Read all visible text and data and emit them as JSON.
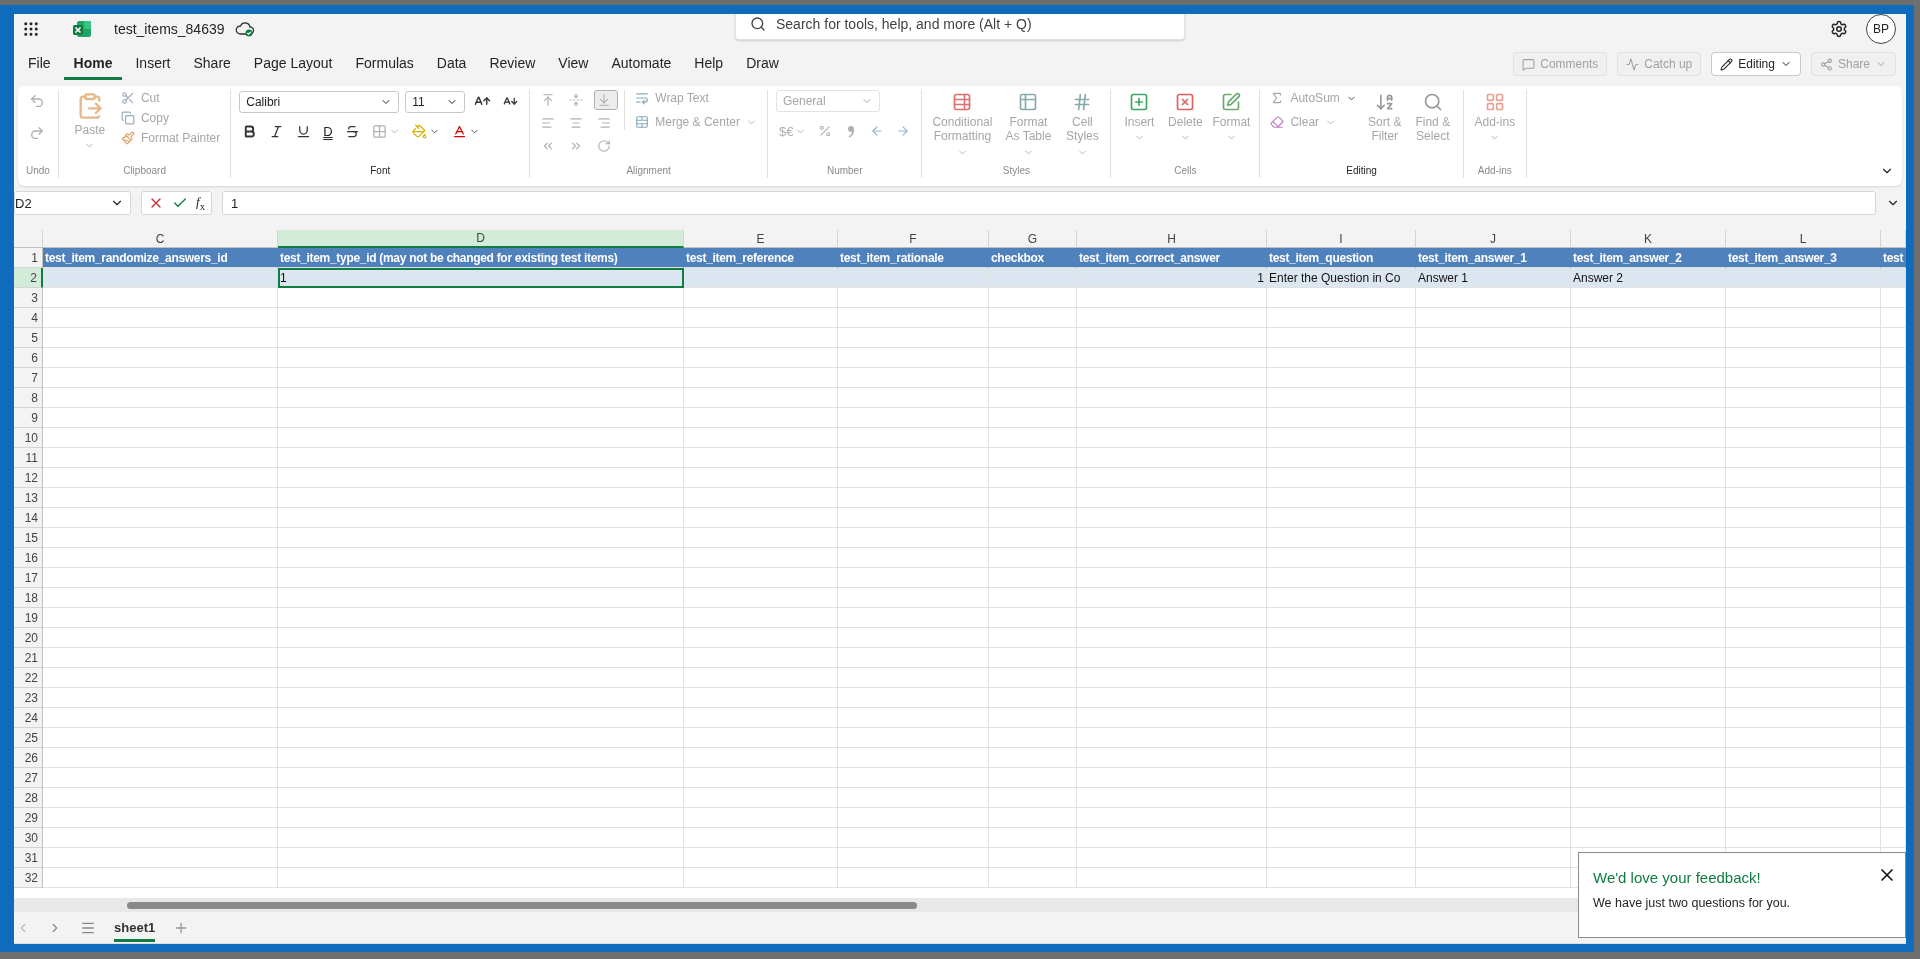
{
  "app_bar": {
    "file_name": "test_items_84639",
    "search": {
      "placeholder": "Search for tools, help, and more (Alt + Q)"
    },
    "avatar": "BP"
  },
  "menu_tabs": [
    {
      "label": "File",
      "selected": false
    },
    {
      "label": "Home",
      "selected": true
    },
    {
      "label": "Insert",
      "selected": false
    },
    {
      "label": "Share",
      "selected": false
    },
    {
      "label": "Page Layout",
      "selected": false
    },
    {
      "label": "Formulas",
      "selected": false
    },
    {
      "label": "Data",
      "selected": false
    },
    {
      "label": "Review",
      "selected": false
    },
    {
      "label": "View",
      "selected": false
    },
    {
      "label": "Automate",
      "selected": false
    },
    {
      "label": "Help",
      "selected": false
    },
    {
      "label": "Draw",
      "selected": false
    }
  ],
  "ribbon_actions": [
    {
      "kind": "plain",
      "label": "Comments",
      "disabled": true
    },
    {
      "kind": "plain",
      "label": "Catch up",
      "disabled": true
    },
    {
      "kind": "dropdown",
      "label": "Editing",
      "disabled": false
    },
    {
      "kind": "dropdown",
      "label": "Share",
      "disabled": true
    }
  ],
  "ribbon_groups": [
    {
      "kind": "undo",
      "title": "Undo",
      "disabled": true,
      "items": [
        {
          "disabled": true
        },
        {
          "disabled": true
        }
      ]
    },
    {
      "kind": "clipboard",
      "title": "Clipboard",
      "disabled": true,
      "items": [
        {
          "label": "Paste",
          "disabled": true
        },
        {
          "label": "Cut",
          "disabled": true
        },
        {
          "label": "Copy",
          "disabled": true
        },
        {
          "label": "Format Painter",
          "disabled": true
        }
      ]
    },
    {
      "kind": "font",
      "title": "Font",
      "disabled": false,
      "font_name": "Calibri",
      "font_size": "11",
      "items": [
        {
          "disabled": false
        },
        {
          "disabled": false
        },
        {
          "disabled": false
        },
        {
          "disabled": false
        },
        {
          "disabled": false
        },
        {
          "label": "D",
          "disabled": false
        },
        {
          "disabled": false
        },
        {
          "disabled": true
        },
        {
          "disabled": false
        },
        {
          "disabled": false
        }
      ]
    },
    {
      "kind": "alignment",
      "title": "Alignment",
      "disabled": true,
      "items": [
        {
          "disabled": true,
          "selected": false
        },
        {
          "disabled": true,
          "selected": false
        },
        {
          "disabled": true,
          "selected": true
        },
        {
          "disabled": true,
          "selected": false
        },
        {
          "disabled": true,
          "selected": false
        },
        {
          "disabled": true,
          "selected": false
        },
        {
          "disabled": true,
          "selected": false
        },
        {
          "disabled": true,
          "selected": false
        },
        {
          "disabled": true,
          "selected": false
        },
        {
          "label": "Wrap Text",
          "disabled": true,
          "selected": false
        },
        {
          "label": "Merge & Center",
          "disabled": true,
          "selected": false
        }
      ]
    },
    {
      "kind": "number",
      "title": "Number",
      "disabled": true,
      "format": "General",
      "items": [
        {
          "label": "$€",
          "disabled": true
        },
        {
          "disabled": true
        },
        {
          "disabled": true
        },
        {
          "disabled": true
        },
        {
          "disabled": true
        }
      ]
    },
    {
      "kind": "styles",
      "title": "Styles",
      "disabled": true,
      "items": [
        {
          "label": "Conditional Formatting",
          "disabled": true
        },
        {
          "label": "Format As Table",
          "disabled": true
        },
        {
          "label": "Cell Styles",
          "disabled": true
        }
      ]
    },
    {
      "kind": "cells",
      "title": "Cells",
      "disabled": true,
      "items": [
        {
          "label": "Insert",
          "disabled": true
        },
        {
          "label": "Delete",
          "disabled": true
        },
        {
          "label": "Format",
          "disabled": true
        }
      ]
    },
    {
      "kind": "editing",
      "title": "Editing",
      "disabled": false,
      "items": [
        {
          "label": "AutoSum",
          "disabled": true
        },
        {
          "label": "Clear",
          "disabled": true
        },
        {
          "label": "Sort & Filter",
          "disabled": true
        },
        {
          "label": "Find & Select",
          "disabled": true
        }
      ]
    },
    {
      "kind": "addins",
      "title": "Add-ins",
      "disabled": true,
      "items": [
        {
          "label": "Add-ins",
          "disabled": true
        }
      ]
    }
  ],
  "formula_bar": {
    "name_box": "D2",
    "function_button": "*f*$_{x}$",
    "formula": "1"
  },
  "sheet": {
    "columns": [
      {
        "letter": "C",
        "selected": false
      },
      {
        "letter": "D",
        "selected": true
      },
      {
        "letter": "E",
        "selected": false
      },
      {
        "letter": "F",
        "selected": false
      },
      {
        "letter": "G",
        "selected": false
      },
      {
        "letter": "H",
        "selected": false
      },
      {
        "letter": "I",
        "selected": false
      },
      {
        "letter": "J",
        "selected": false
      },
      {
        "letter": "K",
        "selected": false
      },
      {
        "letter": "L",
        "selected": false
      },
      {
        "selected": false
      }
    ],
    "rows": [
      {
        "number": "1",
        "selected": false,
        "cells": [
          {
            "kind": "header",
            "text": "test_item_randomize_answers_id",
            "selected": false
          },
          {
            "kind": "header",
            "text": "test_item_type_id (may not be changed for existing test items)",
            "selected": false
          },
          {
            "kind": "header",
            "text": "test_item_reference",
            "selected": false
          },
          {
            "kind": "header",
            "text": "test_item_rationale",
            "selected": false
          },
          {
            "kind": "header",
            "text": "checkbox",
            "selected": false
          },
          {
            "kind": "header",
            "text": "test_item_correct_answer",
            "selected": false
          },
          {
            "kind": "header",
            "text": "test_item_question",
            "selected": false
          },
          {
            "kind": "header",
            "text": "test_item_answer_1",
            "selected": false
          },
          {
            "kind": "header",
            "text": "test_item_answer_2",
            "selected": false
          },
          {
            "kind": "header",
            "text": "test_item_answer_3",
            "selected": false
          },
          {
            "kind": "header",
            "text": "test",
            "selected": false
          }
        ]
      },
      {
        "number": "2",
        "selected": true,
        "cells": [
          {
            "kind": "empty",
            "selected": false
          },
          {
            "kind": "text",
            "text": "1",
            "selected": true
          },
          {
            "kind": "empty",
            "selected": false
          },
          {
            "kind": "empty",
            "selected": false
          },
          {
            "kind": "empty",
            "selected": false
          },
          {
            "kind": "number",
            "text": "1",
            "selected": false
          },
          {
            "kind": "text",
            "text": "Enter the Question in Co",
            "selected": false
          },
          {
            "kind": "text",
            "text": "Answer 1",
            "selected": false
          },
          {
            "kind": "text",
            "text": "Answer 2",
            "selected": false
          },
          {
            "kind": "empty",
            "selected": false
          },
          {
            "kind": "empty",
            "selected": false
          }
        ]
      },
      {
        "number": "3",
        "selected": false
      },
      {
        "number": "4",
        "selected": false
      },
      {
        "number": "5",
        "selected": false
      },
      {
        "number": "6",
        "selected": false
      },
      {
        "number": "7",
        "selected": false
      },
      {
        "number": "8",
        "selected": false
      },
      {
        "number": "9",
        "selected": false
      },
      {
        "number": "10",
        "selected": false
      },
      {
        "number": "11",
        "selected": false
      },
      {
        "number": "12",
        "selected": false
      },
      {
        "number": "13",
        "selected": false
      },
      {
        "number": "14",
        "selected": false
      },
      {
        "number": "15",
        "selected": false
      },
      {
        "number": "16",
        "selected": false
      },
      {
        "number": "17",
        "selected": false
      },
      {
        "number": "18",
        "selected": false
      },
      {
        "number": "19",
        "selected": false
      },
      {
        "number": "20",
        "selected": false
      },
      {
        "number": "21",
        "selected": false
      },
      {
        "number": "22",
        "selected": false
      },
      {
        "number": "23",
        "selected": false
      },
      {
        "number": "24",
        "selected": false
      },
      {
        "number": "25",
        "selected": false
      },
      {
        "number": "26",
        "selected": false
      },
      {
        "number": "27",
        "selected": false
      },
      {
        "number": "28",
        "selected": false
      },
      {
        "number": "29",
        "selected": false
      },
      {
        "number": "30",
        "selected": false
      },
      {
        "number": "31",
        "selected": false
      },
      {
        "number": "32",
        "selected": false
      }
    ]
  },
  "sheet_tabs": [
    {
      "label": "sheet1",
      "selected": true
    }
  ],
  "feedback": {
    "title": "We'd love your feedback!",
    "message": "We have just two questions for you."
  }
}
